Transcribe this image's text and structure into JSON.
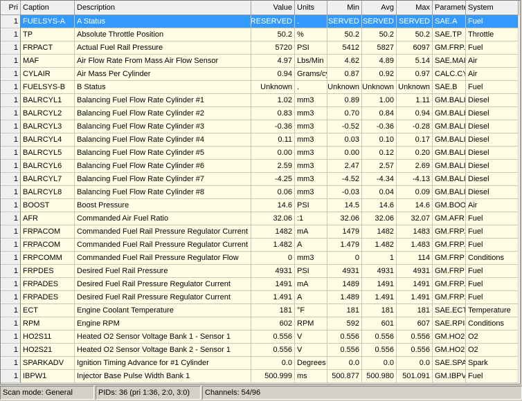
{
  "columns": [
    "Pri",
    "Caption",
    "Description",
    "Value",
    "Units",
    "Min",
    "Avg",
    "Max",
    "Paramete",
    "System"
  ],
  "selected_row": 0,
  "rows": [
    [
      "1",
      "FUELSYS-A",
      "A Status",
      "RESERVED",
      ".",
      "SERVED",
      "SERVED",
      "SERVED",
      "SAE.A",
      "Fuel"
    ],
    [
      "1",
      "TP",
      "Absolute Throttle Position",
      "50.2",
      "%",
      "50.2",
      "50.2",
      "50.2",
      "SAE.TP",
      "Throttle"
    ],
    [
      "1",
      "FRPACT",
      "Actual Fuel Rail Pressure",
      "5720",
      "PSI",
      "5412",
      "5827",
      "6097",
      "GM.FRP.",
      "Fuel"
    ],
    [
      "1",
      "MAF",
      "Air Flow Rate From Mass Air Flow Sensor",
      "4.97",
      "Lbs/Min",
      "4.62",
      "4.89",
      "5.14",
      "SAE.MAI",
      "Air"
    ],
    [
      "1",
      "CYLAIR",
      "Air Mass Per Cylinder",
      "0.94",
      "Grams/cy",
      "0.87",
      "0.92",
      "0.97",
      "CALC.CY",
      "Air"
    ],
    [
      "1",
      "FUELSYS-B",
      "B Status",
      "Unknown",
      ".",
      "Unknown",
      "Unknown",
      "Unknown",
      "SAE.B",
      "Fuel"
    ],
    [
      "1",
      "BALRCYL1",
      "Balancing Fuel Flow Rate Cylinder #1",
      "1.02",
      "mm3",
      "0.89",
      "1.00",
      "1.11",
      "GM.BALI",
      "Diesel"
    ],
    [
      "1",
      "BALRCYL2",
      "Balancing Fuel Flow Rate Cylinder #2",
      "0.83",
      "mm3",
      "0.70",
      "0.84",
      "0.94",
      "GM.BALI",
      "Diesel"
    ],
    [
      "1",
      "BALRCYL3",
      "Balancing Fuel Flow Rate Cylinder #3",
      "-0.36",
      "mm3",
      "-0.52",
      "-0.36",
      "-0.28",
      "GM.BALI",
      "Diesel"
    ],
    [
      "1",
      "BALRCYL4",
      "Balancing Fuel Flow Rate Cylinder #4",
      "0.11",
      "mm3",
      "0.03",
      "0.10",
      "0.17",
      "GM.BALI",
      "Diesel"
    ],
    [
      "1",
      "BALRCYL5",
      "Balancing Fuel Flow Rate Cylinder #5",
      "0.00",
      "mm3",
      "0.00",
      "0.12",
      "0.20",
      "GM.BALI",
      "Diesel"
    ],
    [
      "1",
      "BALRCYL6",
      "Balancing Fuel Flow Rate Cylinder #6",
      "2.59",
      "mm3",
      "2.47",
      "2.57",
      "2.69",
      "GM.BALI",
      "Diesel"
    ],
    [
      "1",
      "BALRCYL7",
      "Balancing Fuel Flow Rate Cylinder #7",
      "-4.25",
      "mm3",
      "-4.52",
      "-4.34",
      "-4.13",
      "GM.BALI",
      "Diesel"
    ],
    [
      "1",
      "BALRCYL8",
      "Balancing Fuel Flow Rate Cylinder #8",
      "0.06",
      "mm3",
      "-0.03",
      "0.04",
      "0.09",
      "GM.BALI",
      "Diesel"
    ],
    [
      "1",
      "BOOST",
      "Boost Pressure",
      "14.6",
      "PSI",
      "14.5",
      "14.6",
      "14.6",
      "GM.BOO",
      "Air"
    ],
    [
      "1",
      "AFR",
      "Commanded Air Fuel Ratio",
      "32.06",
      ":1",
      "32.06",
      "32.06",
      "32.07",
      "GM.AFR",
      "Fuel"
    ],
    [
      "1",
      "FRPACOM",
      "Commanded Fuel Rail Pressure Regulator Current",
      "1482",
      "mA",
      "1479",
      "1482",
      "1483",
      "GM.FRP.",
      "Fuel"
    ],
    [
      "1",
      "FRPACOM",
      "Commanded Fuel Rail Pressure Regulator Current",
      "1.482",
      "A",
      "1.479",
      "1.482",
      "1.483",
      "GM.FRP.",
      "Fuel"
    ],
    [
      "1",
      "FRPCOMM",
      "Commanded Fuel Rail Pressure Regulator Flow",
      "0",
      "mm3",
      "0",
      "1",
      "114",
      "GM.FRP",
      "Conditions"
    ],
    [
      "1",
      "FRPDES",
      "Desired Fuel Rail Pressure",
      "4931",
      "PSI",
      "4931",
      "4931",
      "4931",
      "GM.FRP",
      "Fuel"
    ],
    [
      "1",
      "FRPADES",
      "Desired Fuel Rail Pressure Regulator Current",
      "1491",
      "mA",
      "1489",
      "1491",
      "1491",
      "GM.FRP.",
      "Fuel"
    ],
    [
      "1",
      "FRPADES",
      "Desired Fuel Rail Pressure Regulator Current",
      "1.491",
      "A",
      "1.489",
      "1.491",
      "1.491",
      "GM.FRP.",
      "Fuel"
    ],
    [
      "1",
      "ECT",
      "Engine Coolant Temperature",
      "181",
      "°F",
      "181",
      "181",
      "181",
      "SAE.ECT",
      "Temperature"
    ],
    [
      "1",
      "RPM",
      "Engine RPM",
      "602",
      "RPM",
      "592",
      "601",
      "607",
      "SAE.RPI",
      "Conditions"
    ],
    [
      "1",
      "HO2S11",
      "Heated O2 Sensor Voltage Bank 1 - Sensor 1",
      "0.556",
      "V",
      "0.556",
      "0.556",
      "0.556",
      "GM.HO2",
      "O2"
    ],
    [
      "1",
      "HO2S21",
      "Heated O2 Sensor Voltage Bank 2 - Sensor 1",
      "0.556",
      "V",
      "0.556",
      "0.556",
      "0.556",
      "GM.HO2",
      "O2"
    ],
    [
      "1",
      "SPARKADV",
      "Ignition Timing Advance for #1 Cylinder",
      "0.0",
      "Degrees",
      "0.0",
      "0.0",
      "0.0",
      "SAE.SPA",
      "Spark"
    ],
    [
      "1",
      "IBPW1",
      "Injector Base Pulse Width Bank 1",
      "500.999",
      "ms",
      "500.877",
      "500.980",
      "501.091",
      "GM.IBPV",
      "Fuel"
    ]
  ],
  "status": {
    "scan_mode": "Scan mode: General",
    "pids": "PIDs: 36 (pri 1:36, 2:0, 3:0)",
    "channels": "Channels: 54/96"
  },
  "colors": {
    "selection": "#3399ff",
    "row_bg": "#ffffe6"
  }
}
